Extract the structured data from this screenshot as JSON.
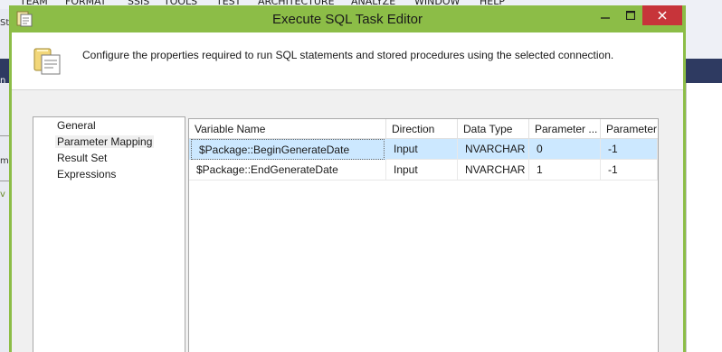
{
  "window": {
    "title": "Execute SQL Task Editor"
  },
  "background_menu": [
    "TEAM",
    "FORMAT",
    "SSIS",
    "TOOLS",
    "TEST",
    "ARCHITECTURE",
    "ANALYZE",
    "WINDOW",
    "HELP"
  ],
  "background_text": {
    "left_top": "St",
    "left_dark": "n",
    "left_mid": "ml",
    "left_low": "v"
  },
  "header": {
    "description": "Configure the properties required to run SQL statements and stored procedures using the selected connection."
  },
  "nav": {
    "items": [
      "General",
      "Parameter Mapping",
      "Result Set",
      "Expressions"
    ],
    "selected": "Parameter Mapping"
  },
  "grid": {
    "columns": [
      "Variable Name",
      "Direction",
      "Data Type",
      "Parameter ...",
      "Parameter"
    ],
    "rows": [
      [
        "$Package::BeginGenerateDate",
        "Input",
        "NVARCHAR",
        "0",
        "-1"
      ],
      [
        "$Package::EndGenerateDate",
        "Input",
        "NVARCHAR",
        "1",
        "-1"
      ]
    ]
  },
  "colors": {
    "title_bar": "#8cbd47",
    "close_button": "#c7343a",
    "selection": "#cce8ff"
  },
  "icons": [
    "dialog-app-icon",
    "minimize-icon",
    "maximize-icon",
    "close-icon",
    "task-header-icon"
  ]
}
